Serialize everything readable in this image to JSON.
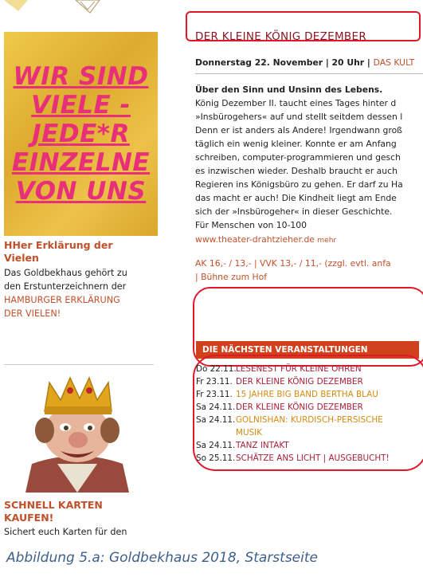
{
  "sidebar": {
    "poster_lines": [
      "WIR SIND",
      "VIELE -",
      "JEDE*R",
      "EINZELNE",
      "VON UNS"
    ],
    "block1": {
      "heading_line1": "HHer Erklärung der",
      "heading_line2": "Vielen",
      "text1": "Das Goldbekhaus gehört zu",
      "text2": "den Erstunterzeichnern der",
      "link1": "HAMBURGER ERKLÄRUNG",
      "link2": "DER VIELEN!"
    },
    "block2": {
      "heading_line1": "SCHNELL KARTEN",
      "heading_line2": "KAUFEN!",
      "text1": "Sichert euch Karten für den"
    }
  },
  "main": {
    "title": "DER KLEINE KÖNIG DEZEMBER",
    "meta_prefix": "Donnerstag 22. November | 20 Uhr | ",
    "meta_venue": "DAS KULT",
    "subtitle": "Über den Sinn und Unsinn des Lebens.",
    "body_lines": [
      "König Dezember II. taucht eines Tages hinter d",
      "»Insbürogehers« auf und stellt seitdem dessen l",
      "Denn er ist anders als Andere! Irgendwann groß",
      "täglich ein wenig kleiner. Konnte er am Anfang",
      "schreiben, computer-programmieren und gesch",
      "es inzwischen wieder. Deshalb braucht er auch",
      "Regieren ins Königsbüro zu gehen. Er darf zu Ha",
      "das macht er auch! Die Kindheit liegt am Ende",
      "sich der »Insbürogeher« in dieser Geschichte.",
      "Für Menschen von 10-100"
    ],
    "website": "www.theater-drahtzieher.de",
    "more": "mehr",
    "price_line": "AK 16,- / 13,- | VVK 13,- / 11,- (zzgl. evtl. anfa",
    "stage": "| Bühne zum Hof"
  },
  "events": {
    "header": "DIE NÄCHSTEN VERANSTALTUNGEN",
    "rows": [
      {
        "date": "Do 22.11.",
        "title": "LESENEST FÜR KLEINE OHREN"
      },
      {
        "date": "Fr 23.11.",
        "title": "DER KLEINE KÖNIG DEZEMBER"
      },
      {
        "date": "Fr 23.11.",
        "title": "15 JAHRE BIG BAND BERTHA BLAU"
      },
      {
        "date": "Sa 24.11.",
        "title": "DER KLEINE KÖNIG DEZEMBER"
      },
      {
        "date": "Sa 24.11.",
        "title": "GOLNISHAN: KURDISCH-PERSISCHE",
        "title2": "MUSIK"
      },
      {
        "date": "Sa 24.11.",
        "title": "TANZ INTAKT"
      },
      {
        "date": "So 25.11.",
        "title": "SCHÄTZE ANS LICHT | AUSGEBUCHT!"
      }
    ]
  },
  "caption": "Abbildung 5.a: Goldbekhaus 2018, Starstseite",
  "colors": {
    "accent_red": "#e0182a",
    "title_color": "#8c1524",
    "link_color": "#c0502a",
    "event_header_bg": "#d0421c",
    "poster_bg": "#e3b838",
    "poster_text": "#e8307a",
    "gold_event": "#d48a12"
  }
}
